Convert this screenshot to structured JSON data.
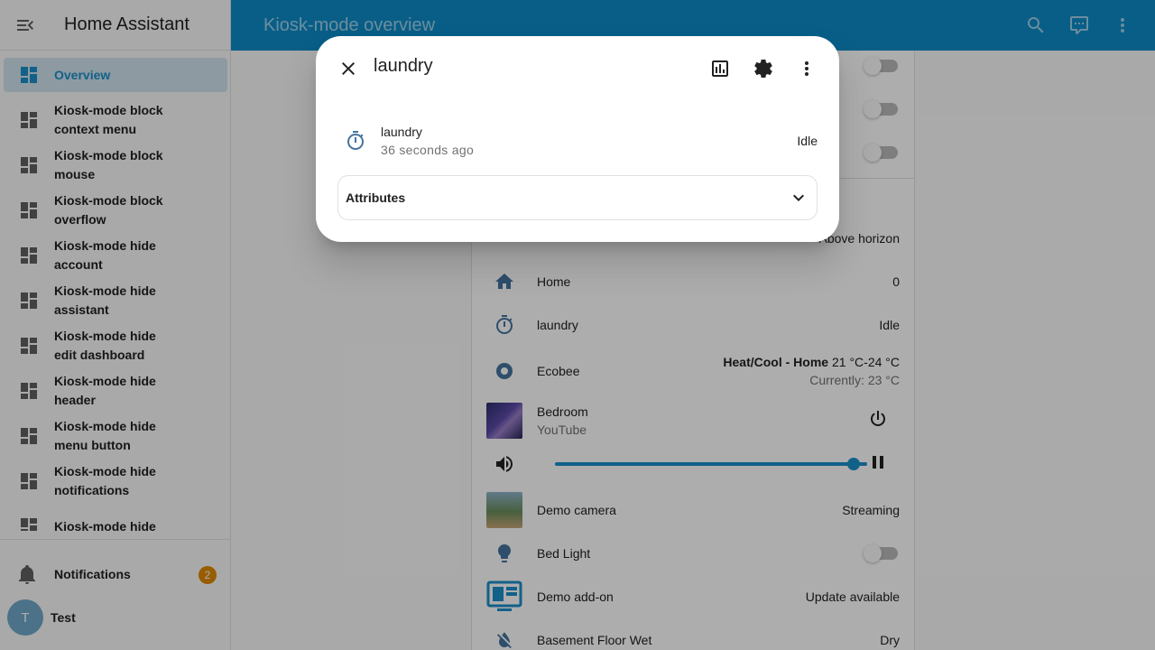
{
  "app": {
    "title": "Home Assistant"
  },
  "topbar": {
    "title": "Kiosk-mode overview"
  },
  "sidebar": {
    "items": [
      {
        "label": "Overview",
        "active": true
      },
      {
        "label": "Kiosk-mode block context menu"
      },
      {
        "label": "Kiosk-mode block mouse"
      },
      {
        "label": "Kiosk-mode block overflow"
      },
      {
        "label": "Kiosk-mode hide account"
      },
      {
        "label": "Kiosk-mode hide assistant"
      },
      {
        "label": "Kiosk-mode hide edit dashboard"
      },
      {
        "label": "Kiosk-mode hide header"
      },
      {
        "label": "Kiosk-mode hide menu button"
      },
      {
        "label": "Kiosk-mode hide notifications"
      },
      {
        "label": "Kiosk-mode hide"
      }
    ],
    "notifications": {
      "label": "Notifications",
      "count": "2"
    },
    "user": {
      "initial": "T",
      "name": "Test"
    }
  },
  "entities": [
    {
      "name": "",
      "state": "Above horizon",
      "icon": "sun-icon"
    },
    {
      "name": "Home",
      "state": "0",
      "icon": "home-icon"
    },
    {
      "name": "laundry",
      "state": "Idle",
      "icon": "timer-icon"
    },
    {
      "name": "Ecobee",
      "state_bold": "Heat/Cool - Home",
      "state": "21 °C-24 °C",
      "sub": "Currently: 23 °C",
      "icon": "thermostat-icon"
    },
    {
      "name": "Bedroom",
      "sub": "YouTube",
      "icon": "media-thumbnail"
    },
    {
      "name": "Demo camera",
      "state": "Streaming",
      "icon": "camera-thumbnail"
    },
    {
      "name": "Bed Light",
      "state": "",
      "icon": "bulb-icon"
    },
    {
      "name": "Demo add-on",
      "state": "Update available",
      "icon": "addon-icon"
    },
    {
      "name": "Basement Floor Wet",
      "state": "Dry",
      "icon": "water-off-icon"
    }
  ],
  "media": {
    "volume_fraction": 1.0
  },
  "dialog": {
    "title": "laundry",
    "entity": {
      "name": "laundry",
      "time": "36 seconds ago",
      "state": "Idle"
    },
    "attributes_label": "Attributes"
  },
  "colors": {
    "accent": "#1b8fcb",
    "header": "#0c8bc8",
    "icon": "#44739e",
    "badge": "#e08a00"
  }
}
